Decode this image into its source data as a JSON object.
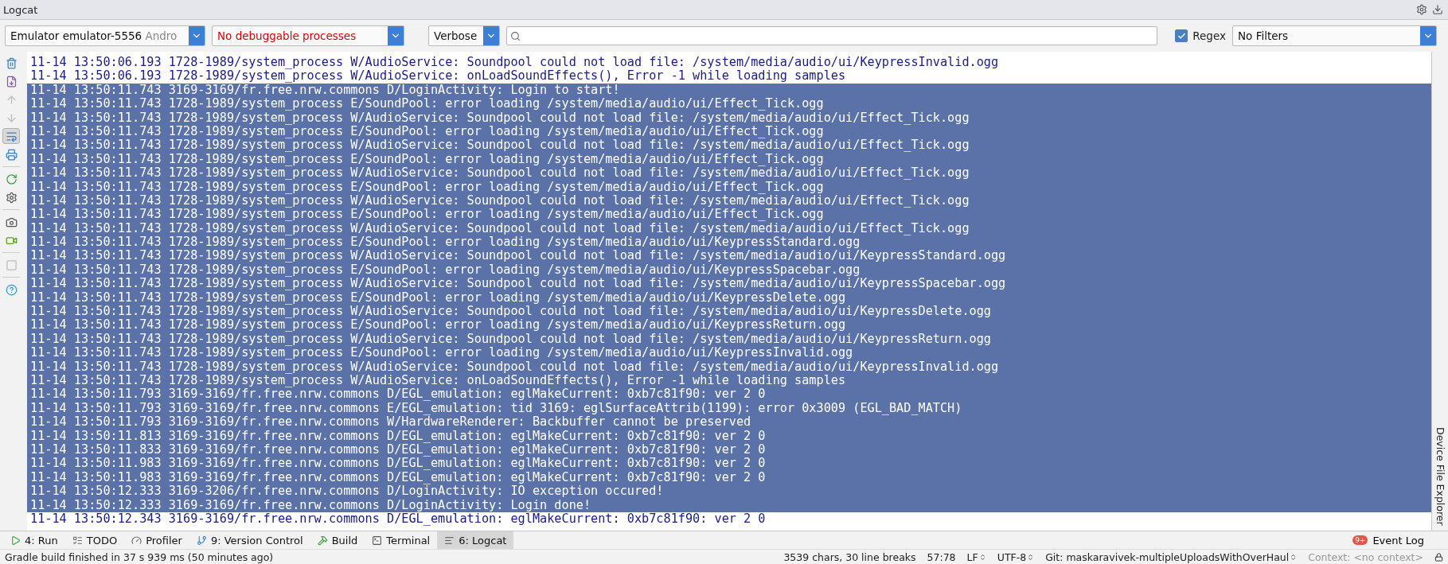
{
  "panel": {
    "title": "Logcat"
  },
  "toolbar": {
    "device": {
      "name": "Emulator emulator-5556",
      "suffix": "Andro"
    },
    "process": {
      "value": "No debuggable processes"
    },
    "level": {
      "value": "Verbose"
    },
    "regex": {
      "label": "Regex",
      "checked": true
    },
    "filter": {
      "value": "No Filters"
    }
  },
  "side_tools": [
    {
      "kind": "trash",
      "disabled": false,
      "selected": false
    },
    {
      "kind": "scroll-end",
      "disabled": false,
      "selected": false
    },
    {
      "kind": "up",
      "disabled": true,
      "selected": false
    },
    {
      "kind": "down",
      "disabled": true,
      "selected": false
    },
    {
      "kind": "wrap",
      "disabled": false,
      "selected": true
    },
    {
      "kind": "print",
      "disabled": false,
      "selected": false
    },
    {
      "kind": "sep"
    },
    {
      "kind": "restart",
      "disabled": false,
      "selected": false
    },
    {
      "kind": "settings",
      "disabled": false,
      "selected": false
    },
    {
      "kind": "sep"
    },
    {
      "kind": "camera",
      "disabled": false,
      "selected": false
    },
    {
      "kind": "record",
      "disabled": false,
      "selected": false
    },
    {
      "kind": "sep"
    },
    {
      "kind": "stop",
      "disabled": true,
      "selected": false
    },
    {
      "kind": "sep"
    },
    {
      "kind": "help",
      "disabled": false,
      "selected": false
    }
  ],
  "log": [
    {
      "text": "11-14 13:50:06.193 1728-1989/system_process W/AudioService: Soundpool could not load file: /system/media/audio/ui/KeypressInvalid.ogg",
      "selected": false
    },
    {
      "text": "11-14 13:50:06.193 1728-1989/system_process W/AudioService: onLoadSoundEffects(), Error -1 while loading samples",
      "selected": false
    },
    {
      "text": "11-14 13:50:11.743 3169-3169/fr.free.nrw.commons D/LoginActivity: Login to start!",
      "selected": true
    },
    {
      "text": "11-14 13:50:11.743 1728-1989/system_process E/SoundPool: error loading /system/media/audio/ui/Effect_Tick.ogg",
      "selected": true
    },
    {
      "text": "11-14 13:50:11.743 1728-1989/system_process W/AudioService: Soundpool could not load file: /system/media/audio/ui/Effect_Tick.ogg",
      "selected": true
    },
    {
      "text": "11-14 13:50:11.743 1728-1989/system_process E/SoundPool: error loading /system/media/audio/ui/Effect_Tick.ogg",
      "selected": true
    },
    {
      "text": "11-14 13:50:11.743 1728-1989/system_process W/AudioService: Soundpool could not load file: /system/media/audio/ui/Effect_Tick.ogg",
      "selected": true
    },
    {
      "text": "11-14 13:50:11.743 1728-1989/system_process E/SoundPool: error loading /system/media/audio/ui/Effect_Tick.ogg",
      "selected": true
    },
    {
      "text": "11-14 13:50:11.743 1728-1989/system_process W/AudioService: Soundpool could not load file: /system/media/audio/ui/Effect_Tick.ogg",
      "selected": true
    },
    {
      "text": "11-14 13:50:11.743 1728-1989/system_process E/SoundPool: error loading /system/media/audio/ui/Effect_Tick.ogg",
      "selected": true
    },
    {
      "text": "11-14 13:50:11.743 1728-1989/system_process W/AudioService: Soundpool could not load file: /system/media/audio/ui/Effect_Tick.ogg",
      "selected": true
    },
    {
      "text": "11-14 13:50:11.743 1728-1989/system_process E/SoundPool: error loading /system/media/audio/ui/Effect_Tick.ogg",
      "selected": true
    },
    {
      "text": "11-14 13:50:11.743 1728-1989/system_process W/AudioService: Soundpool could not load file: /system/media/audio/ui/Effect_Tick.ogg",
      "selected": true
    },
    {
      "text": "11-14 13:50:11.743 1728-1989/system_process E/SoundPool: error loading /system/media/audio/ui/KeypressStandard.ogg",
      "selected": true
    },
    {
      "text": "11-14 13:50:11.743 1728-1989/system_process W/AudioService: Soundpool could not load file: /system/media/audio/ui/KeypressStandard.ogg",
      "selected": true
    },
    {
      "text": "11-14 13:50:11.743 1728-1989/system_process E/SoundPool: error loading /system/media/audio/ui/KeypressSpacebar.ogg",
      "selected": true
    },
    {
      "text": "11-14 13:50:11.743 1728-1989/system_process W/AudioService: Soundpool could not load file: /system/media/audio/ui/KeypressSpacebar.ogg",
      "selected": true
    },
    {
      "text": "11-14 13:50:11.743 1728-1989/system_process E/SoundPool: error loading /system/media/audio/ui/KeypressDelete.ogg",
      "selected": true
    },
    {
      "text": "11-14 13:50:11.743 1728-1989/system_process W/AudioService: Soundpool could not load file: /system/media/audio/ui/KeypressDelete.ogg",
      "selected": true
    },
    {
      "text": "11-14 13:50:11.743 1728-1989/system_process E/SoundPool: error loading /system/media/audio/ui/KeypressReturn.ogg",
      "selected": true
    },
    {
      "text": "11-14 13:50:11.743 1728-1989/system_process W/AudioService: Soundpool could not load file: /system/media/audio/ui/KeypressReturn.ogg",
      "selected": true
    },
    {
      "text": "11-14 13:50:11.743 1728-1989/system_process E/SoundPool: error loading /system/media/audio/ui/KeypressInvalid.ogg",
      "selected": true
    },
    {
      "text": "11-14 13:50:11.743 1728-1989/system_process W/AudioService: Soundpool could not load file: /system/media/audio/ui/KeypressInvalid.ogg",
      "selected": true
    },
    {
      "text": "11-14 13:50:11.743 1728-1989/system_process W/AudioService: onLoadSoundEffects(), Error -1 while loading samples",
      "selected": true
    },
    {
      "text": "11-14 13:50:11.793 3169-3169/fr.free.nrw.commons D/EGL_emulation: eglMakeCurrent: 0xb7c81f90: ver 2 0",
      "selected": true
    },
    {
      "text": "11-14 13:50:11.793 3169-3169/fr.free.nrw.commons E/EGL_emulation: tid 3169: eglSurfaceAttrib(1199): error 0x3009 (EGL_BAD_MATCH)",
      "selected": true
    },
    {
      "text": "11-14 13:50:11.793 3169-3169/fr.free.nrw.commons W/HardwareRenderer: Backbuffer cannot be preserved",
      "selected": true
    },
    {
      "text": "11-14 13:50:11.813 3169-3169/fr.free.nrw.commons D/EGL_emulation: eglMakeCurrent: 0xb7c81f90: ver 2 0",
      "selected": true
    },
    {
      "text": "11-14 13:50:11.833 3169-3169/fr.free.nrw.commons D/EGL_emulation: eglMakeCurrent: 0xb7c81f90: ver 2 0",
      "selected": true
    },
    {
      "text": "11-14 13:50:11.983 3169-3169/fr.free.nrw.commons D/EGL_emulation: eglMakeCurrent: 0xb7c81f90: ver 2 0",
      "selected": true
    },
    {
      "text": "11-14 13:50:11.983 3169-3169/fr.free.nrw.commons D/EGL_emulation: eglMakeCurrent: 0xb7c81f90: ver 2 0",
      "selected": true
    },
    {
      "text": "11-14 13:50:12.333 3169-3206/fr.free.nrw.commons D/LoginActivity: IO exception occured!",
      "selected": true
    },
    {
      "text": "11-14 13:50:12.333 3169-3169/fr.free.nrw.commons D/LoginActivity: Login done!",
      "selected": true
    },
    {
      "text": "11-14 13:50:12.343 3169-3169/fr.free.nrw.commons D/EGL_emulation: eglMakeCurrent: 0xb7c81f90: ver 2 0",
      "selected": false
    }
  ],
  "right_strip": {
    "label": "Device File Explorer"
  },
  "bottom_tabs": [
    {
      "kind": "run",
      "label": "4: Run",
      "selected": false
    },
    {
      "kind": "todo",
      "label": "TODO",
      "selected": false
    },
    {
      "kind": "profiler",
      "label": "Profiler",
      "selected": false
    },
    {
      "kind": "vcs",
      "label": "9: Version Control",
      "selected": false
    },
    {
      "kind": "build",
      "label": "Build",
      "selected": false
    },
    {
      "kind": "terminal",
      "label": "Terminal",
      "selected": false
    },
    {
      "kind": "logcat",
      "label": "6: Logcat",
      "selected": true
    }
  ],
  "event_log": {
    "badge": "9+",
    "label": "Event Log"
  },
  "status_bar": {
    "message": "Gradle build finished in 37 s 939 ms (50 minutes ago)",
    "items": [
      {
        "text": "3539 chars, 30 line breaks",
        "arrows": false
      },
      {
        "text": "57:78",
        "arrows": false
      },
      {
        "text": "LF",
        "arrows": true
      },
      {
        "text": "UTF-8",
        "arrows": true
      },
      {
        "text": "Git: maskaravivek-multipleUploadsWithOverHaul",
        "arrows": true
      },
      {
        "text": "Context: <no context>",
        "arrows": false,
        "muted": true
      }
    ]
  }
}
